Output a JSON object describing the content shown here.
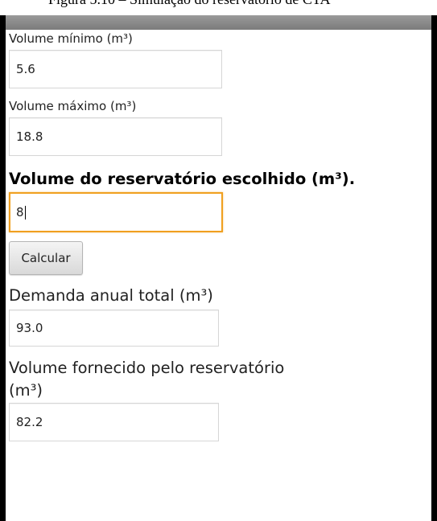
{
  "caption": {
    "text": "Figura 5.10 – Simulação do reservatório de CTA"
  },
  "form": {
    "min_volume": {
      "label": "Volume mínimo (m³)",
      "value": "5.6"
    },
    "max_volume": {
      "label": "Volume máximo (m³)",
      "value": "18.8"
    },
    "chosen_volume": {
      "label": "Volume do reservatório escolhido (m³).",
      "value": "8"
    },
    "calculate_label": "Calcular",
    "annual_demand": {
      "label": "Demanda anual total (m³)",
      "value": "93.0"
    },
    "supplied_volume": {
      "label_line1": "Volume fornecido pelo reservatório",
      "label_line2": "(m³)",
      "value": "82.2"
    }
  },
  "colors": {
    "focus_border": "#f0a020",
    "title_bar": "#8a8a8a",
    "frame": "#000000"
  }
}
